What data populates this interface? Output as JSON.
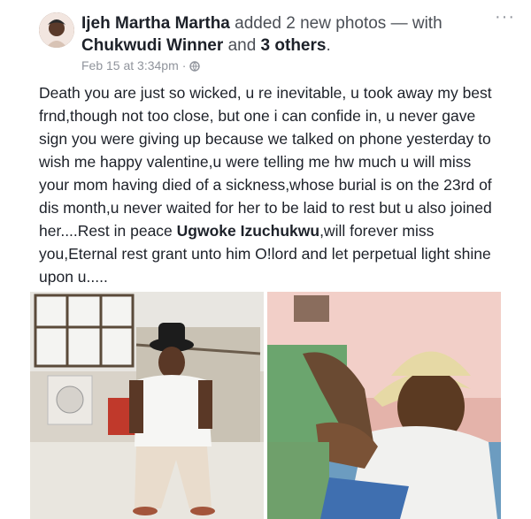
{
  "post": {
    "author": "Ijeh Martha Martha",
    "action": "added 2 new photos — with",
    "tagged": "Chukwudi Winner",
    "and_word": "and",
    "others": "3 others",
    "period": ".",
    "timestamp": "Feb 15 at 3:34pm",
    "separator": "·",
    "privacy_icon": "globe-icon",
    "more_icon": "···",
    "text_part1": "Death you are just so wicked, u re inevitable, u took away my best frnd,though not too close, but one i can confide in, u never gave sign you were giving up because we talked on phone yesterday to wish me happy valentine,u were telling me hw much u will miss your mom having died of a sickness,whose burial is on the 23rd of dis month,u never waited for her to be laid to rest but u also joined her....Rest in peace ",
    "text_bold_name": "Ugwoke Izuchukwu",
    "text_part2": ",will forever miss you,Eternal rest grant unto him O!lord and let perpetual light shine upon u....."
  }
}
